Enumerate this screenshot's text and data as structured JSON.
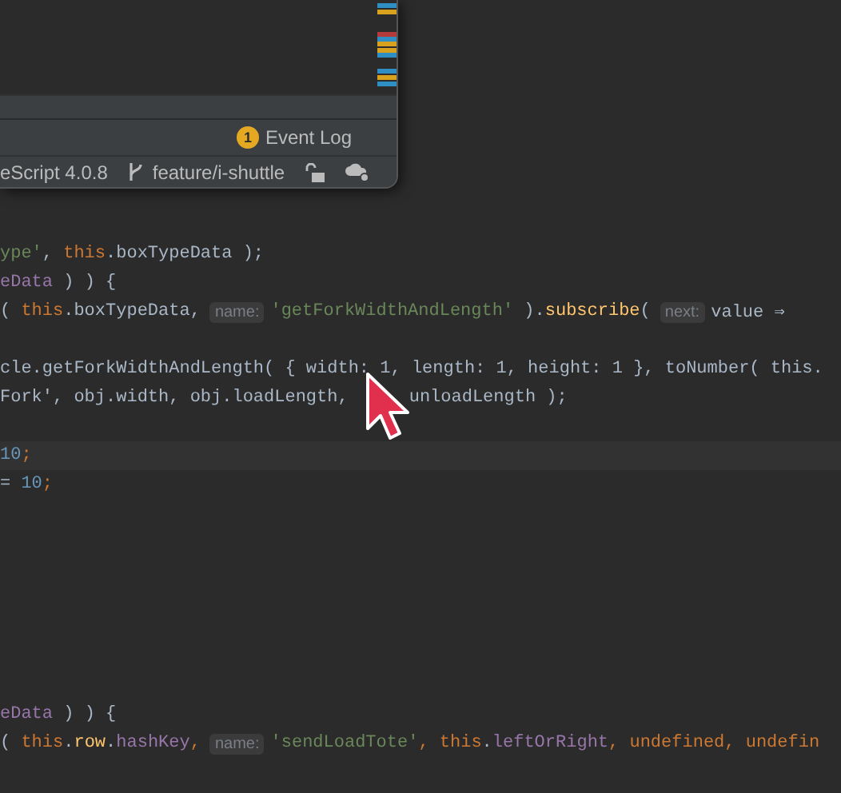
{
  "ide_window": {
    "event_log": {
      "label": "Event Log",
      "badge": "1"
    },
    "status_bar": {
      "language": "eScript 4.0.8",
      "branch": "feature/i-shuttle"
    }
  },
  "editor": {
    "lines": [
      {
        "kind": "code",
        "tokens": [
          {
            "text": "ype'",
            "kind": "string"
          },
          {
            "text": ", ",
            "kind": "plain"
          },
          {
            "text": "this",
            "kind": "keyword"
          },
          {
            "text": ".boxTypeData );",
            "kind": "plain"
          }
        ]
      },
      {
        "kind": "code",
        "tokens": [
          {
            "text": "eData",
            "kind": "property"
          },
          {
            "text": " ) ) {",
            "kind": "plain"
          }
        ]
      },
      {
        "kind": "code",
        "tokens": [
          {
            "text": "( ",
            "kind": "plain"
          },
          {
            "text": "this",
            "kind": "keyword"
          },
          {
            "text": ".boxTypeData,",
            "kind": "plain"
          },
          {
            "text": "name:",
            "kind": "hint"
          },
          {
            "text": "'getForkWidthAndLength'",
            "kind": "string"
          },
          {
            "text": " ).",
            "kind": "plain"
          },
          {
            "text": "subscribe",
            "kind": "function"
          },
          {
            "text": "(",
            "kind": "plain"
          },
          {
            "text": "next:",
            "kind": "hint"
          },
          {
            "text": "value ⇒ ",
            "kind": "plain"
          }
        ]
      },
      {
        "kind": "blank"
      },
      {
        "kind": "code",
        "tokens": [
          {
            "text": "cle.getForkWidthAndLength( { width: 1, length: 1, height: 1 }, toNumber( this.",
            "kind": "plain"
          }
        ]
      },
      {
        "kind": "code",
        "tokens": [
          {
            "text": "Fork', obj.width, obj.loadLength,",
            "kind": "plain"
          },
          {
            "text": "unloadLength );",
            "kind": "plain"
          }
        ]
      },
      {
        "kind": "blank"
      },
      {
        "kind": "current",
        "tokens": [
          {
            "text": "10",
            "kind": "number"
          },
          {
            "text": ";",
            "kind": "keyword"
          }
        ]
      },
      {
        "kind": "code",
        "tokens": [
          {
            "text": "= ",
            "kind": "plain"
          },
          {
            "text": "10",
            "kind": "number"
          },
          {
            "text": ";",
            "kind": "keyword"
          }
        ]
      },
      {
        "kind": "blank"
      },
      {
        "kind": "blank"
      },
      {
        "kind": "blank"
      },
      {
        "kind": "blank"
      },
      {
        "kind": "blank"
      },
      {
        "kind": "blank"
      },
      {
        "kind": "blank"
      },
      {
        "kind": "code",
        "tokens": [
          {
            "text": "eData",
            "kind": "property"
          },
          {
            "text": " ) ) {",
            "kind": "plain"
          }
        ]
      },
      {
        "kind": "code",
        "tokens": [
          {
            "text": "( ",
            "kind": "plain"
          },
          {
            "text": "this",
            "kind": "keyword"
          },
          {
            "text": ".",
            "kind": "plain"
          },
          {
            "text": "row",
            "kind": "function"
          },
          {
            "text": ".",
            "kind": "plain"
          },
          {
            "text": "hashKey",
            "kind": "property"
          },
          {
            "text": ",",
            "kind": "keyword"
          },
          {
            "text": "name:",
            "kind": "hint"
          },
          {
            "text": "'sendLoadTote'",
            "kind": "string"
          },
          {
            "text": ", ",
            "kind": "keyword"
          },
          {
            "text": "this",
            "kind": "keyword"
          },
          {
            "text": ".",
            "kind": "plain"
          },
          {
            "text": "leftOrRight",
            "kind": "property"
          },
          {
            "text": ", undefined, undefin",
            "kind": "keyword"
          }
        ]
      }
    ]
  }
}
